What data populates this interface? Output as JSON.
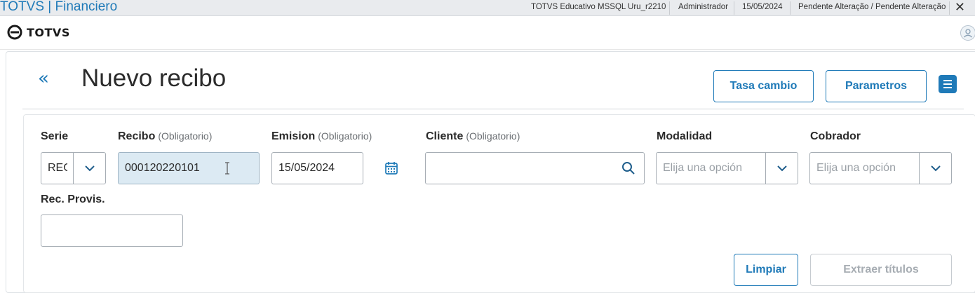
{
  "window": {
    "title": "TOTVS | Financiero",
    "environment": "TOTVS Educativo MSSQL Uru_r2210",
    "user": "Administrador",
    "date": "15/05/2024",
    "pending": "Pendente Alteração / Pendente Alteração",
    "close_icon": "close-icon"
  },
  "brand": {
    "logo_text": "TOTVS",
    "logo_icon": "totvs-logo-icon",
    "avatar_icon": "user-avatar-icon"
  },
  "header": {
    "back_icon": "double-chevron-left-icon",
    "back_glyph": "«",
    "title": "Nuevo recibo",
    "buttons": {
      "tasa_cambio": "Tasa cambio",
      "parametros": "Parametros"
    },
    "menu_icon": "menu-icon"
  },
  "form": {
    "serie": {
      "label": "Serie",
      "value": "REC"
    },
    "recibo": {
      "label": "Recibo",
      "hint": "(Obligatorio)",
      "value": "000120220101"
    },
    "emision": {
      "label": "Emision",
      "hint": "(Obligatorio)",
      "value": "15/05/2024",
      "icon": "calendar-icon"
    },
    "cliente": {
      "label": "Cliente",
      "hint": "(Obligatorio)",
      "value": "",
      "icon": "search-icon"
    },
    "modalidad": {
      "label": "Modalidad",
      "placeholder": "Elija una opción"
    },
    "cobrador": {
      "label": "Cobrador",
      "placeholder": "Elija una opción"
    },
    "rec_provis": {
      "label": "Rec. Provis.",
      "value": ""
    }
  },
  "actions": {
    "limpiar": "Limpiar",
    "extraer_titulos": "Extraer títulos"
  },
  "colors": {
    "accent": "#1f7ab8",
    "filled_field": "#dceaf3",
    "disabled_text": "#a7adb3"
  }
}
